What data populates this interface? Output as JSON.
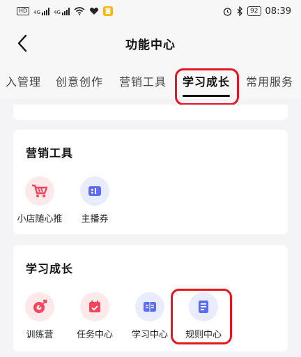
{
  "status_bar": {
    "sim1": "HD",
    "net1": "4G",
    "net2": "4G",
    "battery": "92",
    "time": "08:39",
    "icons": [
      "hd-icon",
      "signal-icon",
      "wifi-icon",
      "heart-icon",
      "app-notification-icon",
      "alarm-icon",
      "bluetooth-icon",
      "battery-icon"
    ]
  },
  "header": {
    "title": "功能中心",
    "back_icon": "chevron-left-icon"
  },
  "tabs": {
    "items": [
      {
        "label": "入管理",
        "display": "入管理"
      },
      {
        "label": "创意创作"
      },
      {
        "label": "营销工具"
      },
      {
        "label": "学习成长",
        "active": true
      },
      {
        "label": "常用服务"
      }
    ]
  },
  "sections": {
    "marketing": {
      "title": "营销工具",
      "tools": [
        {
          "label": "小店随心推",
          "icon": "shopping-cart-icon",
          "tint": "pink"
        },
        {
          "label": "主播券",
          "icon": "ticket-icon",
          "tint": "blue"
        }
      ]
    },
    "learning": {
      "title": "学习成长",
      "tools": [
        {
          "label": "训练营",
          "icon": "target-icon",
          "tint": "pink"
        },
        {
          "label": "任务中心",
          "icon": "calendar-icon",
          "tint": "pink"
        },
        {
          "label": "学习中心",
          "icon": "book-icon",
          "tint": "blue"
        },
        {
          "label": "规则中心",
          "icon": "document-icon",
          "tint": "blue"
        }
      ]
    }
  },
  "colors": {
    "highlight": "#e4161f",
    "pink_icon": "#f5455c",
    "blue_icon": "#5b6ef0"
  }
}
